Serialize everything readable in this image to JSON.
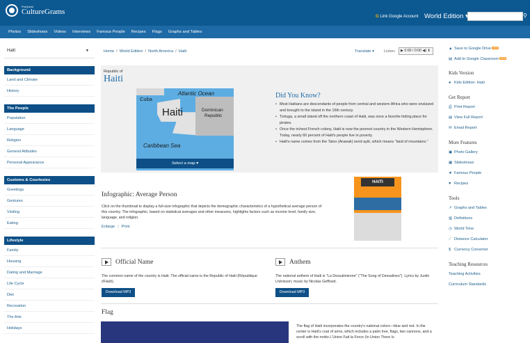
{
  "topbar": {
    "logo_sup": "ProQuest",
    "logo_main": "CultureGrams",
    "google_icon": "G",
    "google_link": "Link Google Account",
    "edition": "World Edition",
    "edition_caret": "▾"
  },
  "nav": [
    "Photos",
    "Slideshows",
    "Videos",
    "Interviews",
    "Famous People",
    "Recipes",
    "Flags",
    "Graphs and Tables"
  ],
  "sidebar": {
    "country": "Haiti",
    "sections": [
      {
        "title": "Background",
        "items": [
          "Land and Climate",
          "History"
        ]
      },
      {
        "title": "The People",
        "items": [
          "Population",
          "Language",
          "Religion",
          "General Attitudes",
          "Personal Appearance"
        ]
      },
      {
        "title": "Customs & Courtesies",
        "items": [
          "Greetings",
          "Gestures",
          "Visiting",
          "Eating"
        ]
      },
      {
        "title": "Lifestyle",
        "items": [
          "Family",
          "Housing",
          "Dating and Marriage",
          "Life Cycle",
          "Diet",
          "Recreation",
          "The Arts",
          "Holidays"
        ]
      }
    ]
  },
  "breadcrumb": [
    "Home",
    "/",
    "World Edition",
    "/",
    "North America",
    "/",
    "Haiti"
  ],
  "translate": "Translate ▾",
  "listen": "Listen:",
  "player": "▶ 0:00 / 0:00 ◀) ⬇",
  "hero": {
    "republic": "Republic of",
    "country": "Haiti",
    "map_labels": {
      "atlantic": "Atlantic Ocean",
      "cuba": "Cuba",
      "haiti": "Haiti",
      "dominican": "Dominican",
      "republic": "Republic",
      "caribbean": "Caribbean Sea"
    },
    "map_button": "Select a map ▾"
  },
  "did_you_know": {
    "title": "Did You Know?",
    "items": [
      "Most Haitians are descendants of people from central and western Africa who were enslaved and brought to the island in the 16th century.",
      "Tortuga, a small island off the northern coast of Haiti, was once a favorite hiding place for pirates.",
      "Once the richest French colony, Haiti is now the poorest country in the Western Hemisphere. Today, nearly 60 percent of Haiti's people live in poverty.",
      "Haiti's name comes from the Taino (Arawak) word ayiti, which means \"land of mountains.\""
    ]
  },
  "infographic": {
    "title": "Infographic: Average Person",
    "desc": "Click on the thumbnail to display a full-size infographic that depicts the demographic characteristics of a hypothetical average person of this country. The infographic, based on statistical averages and other measures, highlights factors such as income level, family size, language, and religion.",
    "enlarge": "Enlarge",
    "print": "Print",
    "thumb_title": "HAITI"
  },
  "official_name": {
    "title": "Official Name",
    "text": "The common name of the country is Haiti. The official name is the Republic of Haiti (République d'Haïti).",
    "button": "Download MP3"
  },
  "anthem": {
    "title": "Anthem",
    "text": "The national anthem of Haiti is \"La Dessalinienne\" (\"The Song of Dessalines\"). Lyrics by Justin Lhérisson; music by Nicolas Geffrard.",
    "button": "Download MP3"
  },
  "flag": {
    "title": "Flag",
    "text": "The flag of Haiti incorporates the country's national colors—blue and red. In the center is Haiti's coat of arms, which includes a palm tree, flags, two cannons, and a scroll with the motto L'Union Fait la Force (In Union There Is"
  },
  "right": {
    "top_links": [
      {
        "icon": "▲",
        "label": "Save to Google Drive",
        "badge": "NEW"
      },
      {
        "icon": "▤",
        "label": "Add to Google Classroom",
        "badge": "NEW"
      }
    ],
    "groups": [
      {
        "title": "Kids Version",
        "links": [
          {
            "icon": "●",
            "label": "Kids Edition: Haiti"
          }
        ]
      },
      {
        "title": "Get Report",
        "links": [
          {
            "icon": "⎙",
            "label": "Print Report"
          },
          {
            "icon": "▤",
            "label": "View Full Report"
          },
          {
            "icon": "✉",
            "label": "Email Report"
          }
        ]
      },
      {
        "title": "More Features",
        "links": [
          {
            "icon": "▣",
            "label": "Photo Gallery"
          },
          {
            "icon": "▦",
            "label": "Slideshows"
          },
          {
            "icon": "★",
            "label": "Famous People"
          },
          {
            "icon": "♥",
            "label": "Recipes"
          }
        ]
      },
      {
        "title": "Tools",
        "links": [
          {
            "icon": "↗",
            "label": "Graphs and Tables"
          },
          {
            "icon": "▥",
            "label": "Definitions"
          },
          {
            "icon": "◷",
            "label": "World Time"
          },
          {
            "icon": "⟋",
            "label": "Distance Calculator"
          },
          {
            "icon": "$",
            "label": "Currency Converter"
          }
        ]
      },
      {
        "title": "Teaching Resources",
        "links": [
          {
            "icon": "",
            "label": "Teaching Activities"
          },
          {
            "icon": "",
            "label": "Curriculum Standards"
          }
        ]
      }
    ]
  }
}
